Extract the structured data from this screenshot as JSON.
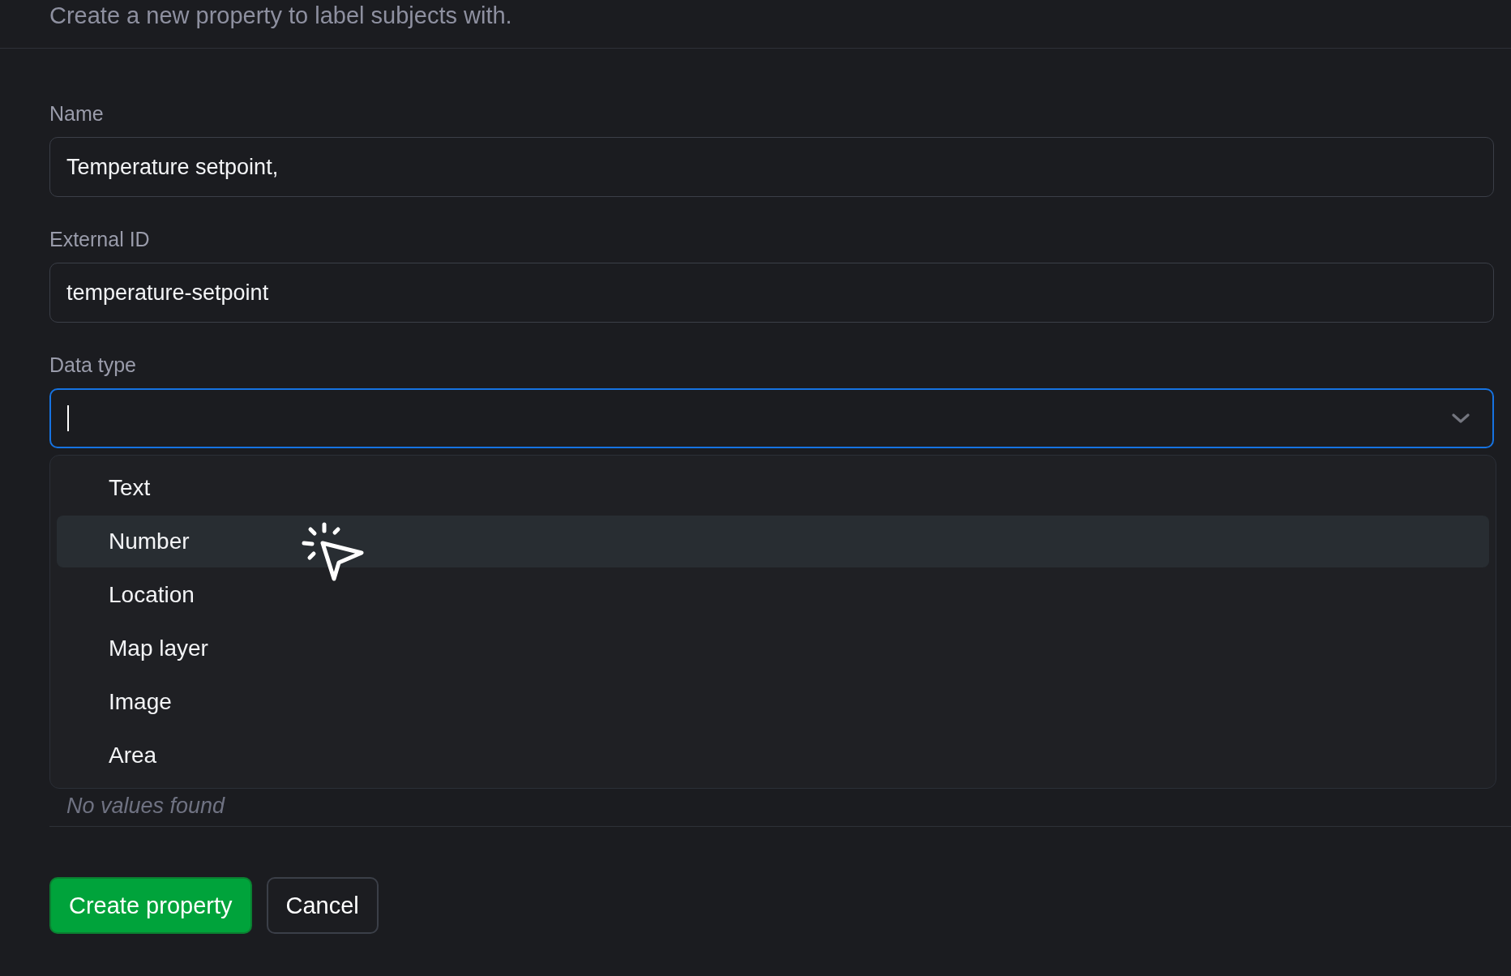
{
  "header": {
    "subtitle": "Create a new property to label subjects with."
  },
  "form": {
    "fields": [
      {
        "kind": "text",
        "label": "Name",
        "value": "Temperature setpoint,"
      },
      {
        "kind": "text",
        "label": "External ID",
        "value": "temperature-setpoint"
      },
      {
        "kind": "select",
        "label": "Data type",
        "focused": true,
        "expanded": true,
        "options": [
          {
            "label": "Text",
            "highlighted": false,
            "selected": false
          },
          {
            "label": "Number",
            "highlighted": true,
            "selected": false
          },
          {
            "label": "Location",
            "highlighted": false,
            "selected": false
          },
          {
            "label": "Map layer",
            "highlighted": false,
            "selected": false
          },
          {
            "label": "Image",
            "highlighted": false,
            "selected": false
          },
          {
            "label": "Area",
            "highlighted": false,
            "selected": false
          }
        ]
      }
    ],
    "values": {
      "empty_text": "No values found"
    }
  },
  "buttons": [
    {
      "label": "Create property",
      "kind": "primary"
    },
    {
      "label": "Cancel",
      "kind": "secondary"
    }
  ]
}
